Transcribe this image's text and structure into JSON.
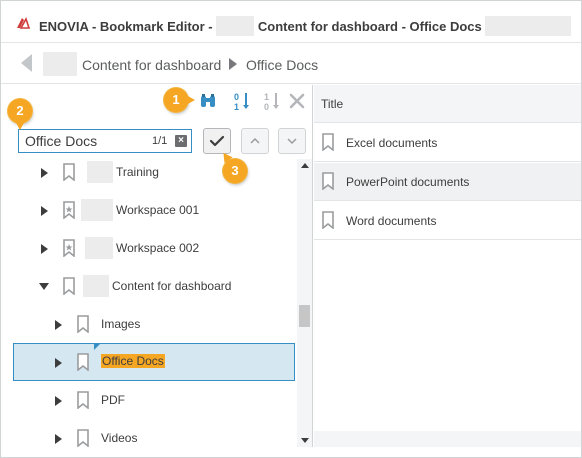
{
  "window": {
    "title_prefix": "ENOVIA - Bookmark Editor -",
    "title_middle": "Content for dashboard - Office Docs"
  },
  "breadcrumb": {
    "items": [
      "Content for dashboard",
      "Office Docs"
    ]
  },
  "toolbar": {
    "icons": [
      "binoculars-icon",
      "sort-ascending-icon",
      "sort-descending-icon",
      "close-icon"
    ]
  },
  "search": {
    "value": "Office Docs",
    "match_count": "1/1",
    "clear_icon": "close-box-icon",
    "confirm_icon": "checkmark-icon",
    "prev_icon": "chevron-up-icon",
    "next_icon": "chevron-down-icon"
  },
  "tree": {
    "items": [
      {
        "label": "Training",
        "state": "collapsed",
        "level": 0
      },
      {
        "label": "Workspace 001",
        "state": "collapsed",
        "level": 0
      },
      {
        "label": "Workspace 002",
        "state": "collapsed",
        "level": 0
      },
      {
        "label": "Content for dashboard",
        "state": "expanded",
        "level": 0
      },
      {
        "label": "Images",
        "state": "collapsed",
        "level": 1
      },
      {
        "label": "Office Docs",
        "state": "collapsed",
        "level": 1,
        "selected": true
      },
      {
        "label": "PDF",
        "state": "collapsed",
        "level": 1
      },
      {
        "label": "Videos",
        "state": "collapsed",
        "level": 1
      }
    ]
  },
  "content": {
    "column_title": "Title",
    "rows": [
      "Excel documents",
      "PowerPoint documents",
      "Word documents"
    ]
  },
  "callouts": [
    "1",
    "2",
    "3"
  ],
  "colors": {
    "accent": "#368ec4",
    "callout": "#f5a623",
    "selection": "#d5e8f2",
    "brand": "#cf3c3c"
  }
}
